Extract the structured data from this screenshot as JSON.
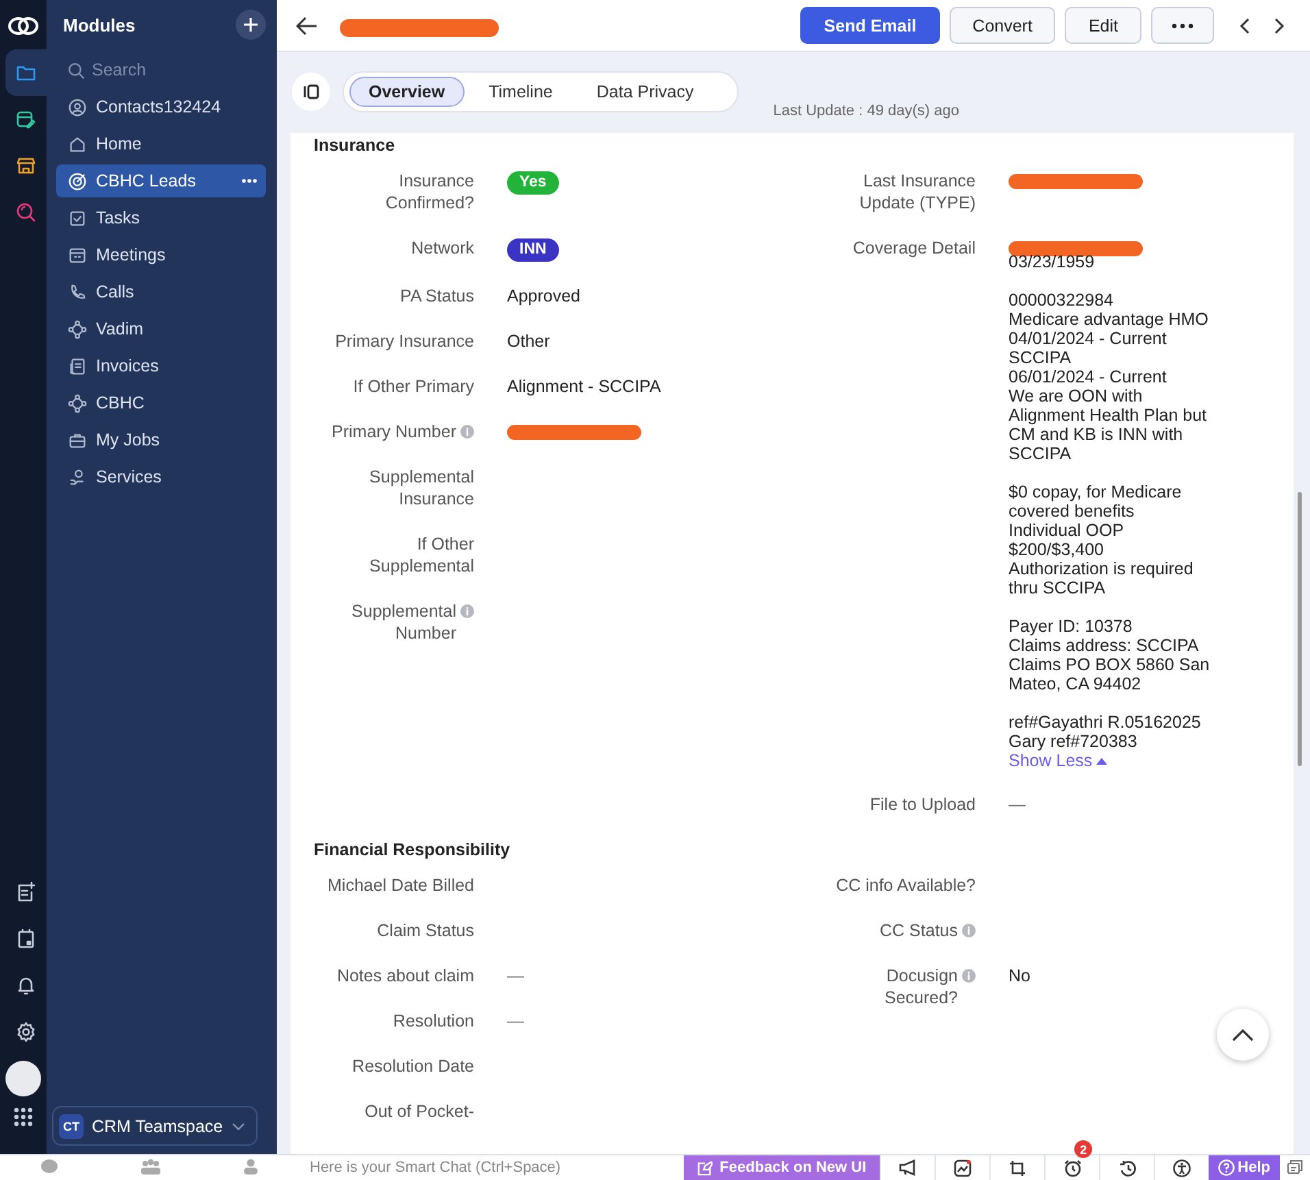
{
  "sidebar": {
    "title": "Modules",
    "search": {
      "placeholder": "Search"
    },
    "items": [
      {
        "label": "Contacts132424",
        "selected": false
      },
      {
        "label": "Home",
        "selected": false
      },
      {
        "label": "CBHC Leads",
        "selected": true
      },
      {
        "label": "Tasks",
        "selected": false
      },
      {
        "label": "Meetings",
        "selected": false
      },
      {
        "label": "Calls",
        "selected": false
      },
      {
        "label": "Vadim",
        "selected": false
      },
      {
        "label": "Invoices",
        "selected": false
      },
      {
        "label": "CBHC",
        "selected": false
      },
      {
        "label": "My Jobs",
        "selected": false
      },
      {
        "label": "Services",
        "selected": false
      }
    ],
    "workspace": {
      "badge": "CT",
      "label": "CRM Teamspace"
    }
  },
  "header": {
    "buttons": [
      {
        "label": "Send Email",
        "kind": "primary"
      },
      {
        "label": "Convert",
        "kind": "secondary"
      },
      {
        "label": "Edit",
        "kind": "secondary"
      }
    ]
  },
  "tabs": [
    {
      "label": "Overview",
      "selected": true
    },
    {
      "label": "Timeline",
      "selected": false
    },
    {
      "label": "Data Privacy",
      "selected": false
    }
  ],
  "last_update": "Last Update : 49 day(s) ago",
  "sections": [
    {
      "title": "Insurance",
      "columns": [
        [
          {
            "label": "Insurance Confirmed?",
            "info": false,
            "value": {
              "kind": "badge",
              "text": "Yes",
              "color": "#22b33a"
            }
          },
          {
            "label": "Network",
            "info": false,
            "value": {
              "kind": "badge",
              "text": "INN",
              "color": "#3a34c4"
            }
          },
          {
            "label": "PA Status",
            "info": false,
            "value": {
              "kind": "text",
              "text": "Approved"
            }
          },
          {
            "label": "Primary Insurance",
            "info": false,
            "value": {
              "kind": "text",
              "text": "Other"
            }
          },
          {
            "label": "If Other Primary",
            "info": false,
            "value": {
              "kind": "text",
              "text": "Alignment - SCCIPA"
            }
          },
          {
            "label": "Primary Number",
            "info": true,
            "value": {
              "kind": "redacted"
            }
          },
          {
            "label": "Supplemental Insurance",
            "info": false
          },
          {
            "label": "If Other Supplemental",
            "info": false
          },
          {
            "label": "Supplemental Number",
            "info": true
          }
        ],
        [
          {
            "label": "Last Insurance Update (TYPE)",
            "info": false,
            "value": {
              "kind": "redacted"
            }
          },
          {
            "label": "Coverage Detail",
            "info": false,
            "value": {
              "kind": "redacted_text",
              "text": "03/23/1959\n\n00000322984\nMedicare advantage HMO\n04/01/2024 - Current\nSCCIPA\n06/01/2024 - Current\nWe are OON with\nAlignment Health Plan but\nCM and KB is INN with\nSCCIPA\n\n$0 copay, for Medicare\ncovered benefits\nIndividual OOP\n$200/$3,400\nAuthorization is required\nthru SCCIPA\n\nPayer ID: 10378\nClaims address: SCCIPA\nClaims PO BOX 5860 San\nMateo, CA 94402\n\nref#Gayathri R.05162025\nGary ref#720383",
              "link": "Show Less"
            }
          },
          {
            "label": "File to Upload",
            "info": false,
            "value": {
              "kind": "dash",
              "text": "—"
            }
          }
        ]
      ]
    },
    {
      "title": "Financial Responsibility",
      "columns": [
        [
          {
            "label": "Michael Date Billed",
            "info": false
          },
          {
            "label": "Claim Status",
            "info": false
          },
          {
            "label": "Notes about claim",
            "info": false,
            "value": {
              "kind": "dash",
              "text": "—"
            }
          },
          {
            "label": "Resolution",
            "info": false,
            "value": {
              "kind": "dash",
              "text": "—"
            }
          },
          {
            "label": "Resolution Date",
            "info": false
          },
          {
            "label": "Out of Pocket-",
            "info": false
          }
        ],
        [
          {
            "label": "CC info Available?",
            "info": false
          },
          {
            "label": "CC Status",
            "info": true
          },
          {
            "label": "Docusign Secured?",
            "info": true,
            "value": {
              "kind": "text",
              "text": "No"
            }
          }
        ]
      ]
    }
  ],
  "bottom_bar": {
    "smart_chat": {
      "placeholder": "Here is your Smart Chat (Ctrl+Space)"
    },
    "feedback": "Feedback on New UI",
    "notification_count": "2",
    "help": "Help"
  }
}
